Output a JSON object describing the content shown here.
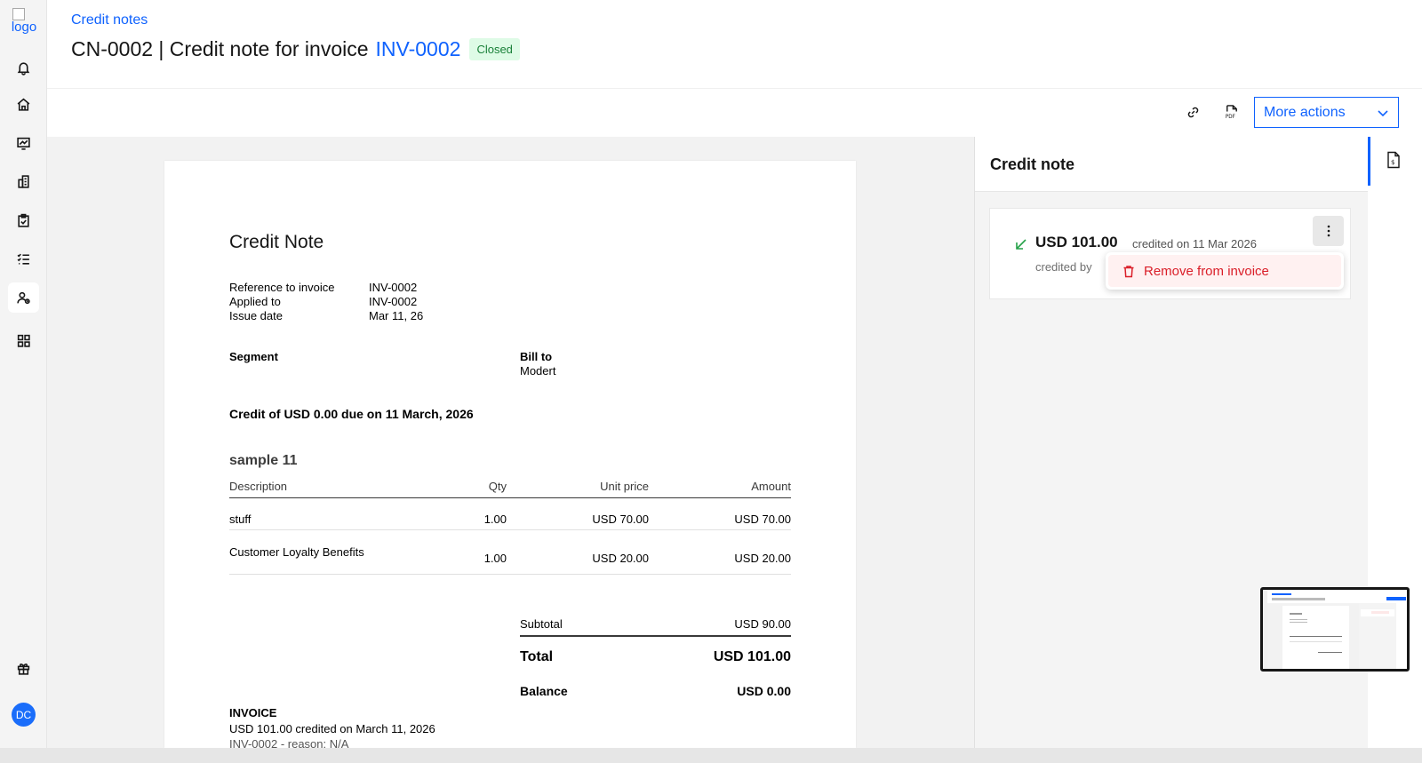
{
  "logo_alt": "logo",
  "header": {
    "breadcrumb": "Credit notes",
    "title_prefix": "CN-0002 | Credit note for invoice",
    "invoice_link": "INV-0002",
    "status": "Closed"
  },
  "toolbar": {
    "more_actions_label": "More actions"
  },
  "document": {
    "title": "Credit Note",
    "meta": [
      {
        "label": "Reference to invoice",
        "value": "INV-0002"
      },
      {
        "label": "Applied to",
        "value": "INV-0002"
      },
      {
        "label": "Issue date",
        "value": "Mar 11, 26"
      }
    ],
    "segment_label": "Segment",
    "bill_to_label": "Bill to",
    "bill_to_value": "Modert",
    "credit_due": "Credit of USD 0.00 due on 11 March, 2026",
    "section_title": "sample 11",
    "columns": {
      "description": "Description",
      "qty": "Qty",
      "unit_price": "Unit price",
      "amount": "Amount"
    },
    "rows": [
      {
        "description": "stuff",
        "qty": "1.00",
        "unit_price": "USD 70.00",
        "amount": "USD 70.00"
      },
      {
        "description": "Customer Loyalty Benefits",
        "qty": "1.00",
        "unit_price": "USD 20.00",
        "amount": "USD 20.00"
      }
    ],
    "subtotal_label": "Subtotal",
    "subtotal_value": "USD 90.00",
    "total_label": "Total",
    "total_value": "USD 101.00",
    "balance_label": "Balance",
    "balance_value": "USD 0.00",
    "invoice_heading": "INVOICE",
    "invoice_line1": "USD 101.00 credited on March 11, 2026",
    "invoice_line2": "INV-0002 - reason: N/A"
  },
  "panel": {
    "title": "Credit note",
    "card": {
      "amount": "USD 101.00",
      "created_text": "credited on 11 Mar 2026",
      "credited_by": "credited by"
    },
    "menu_item": "Remove from invoice"
  },
  "user": {
    "initials": "DC"
  },
  "colors": {
    "accent": "#0f62fe",
    "status_bg": "#defbe6",
    "status_text": "#198038",
    "danger": "#da1e28"
  }
}
